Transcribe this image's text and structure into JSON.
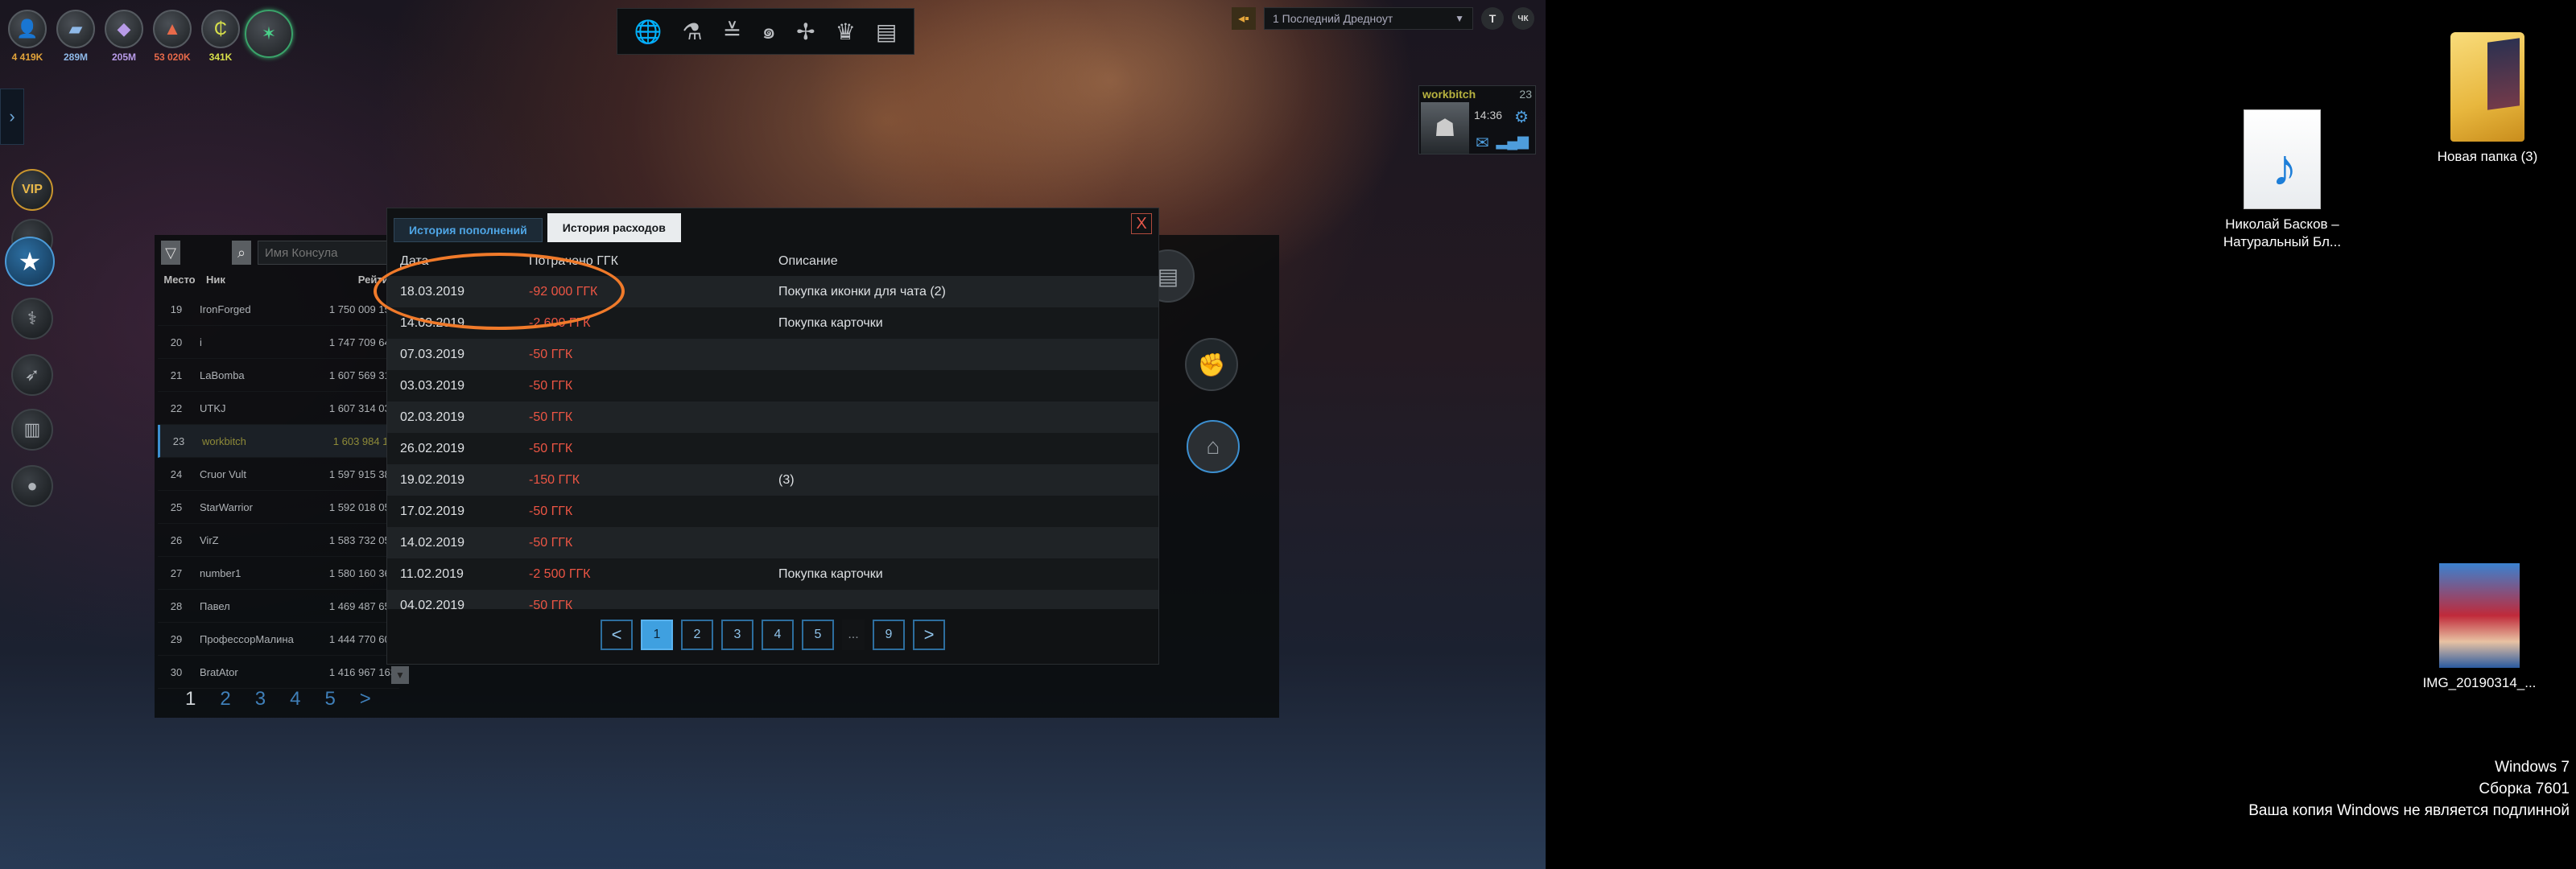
{
  "resources": [
    {
      "icon": "population-icon",
      "glyph": "👤",
      "value": "4 419K",
      "color": "#e3a43a"
    },
    {
      "icon": "metal-icon",
      "glyph": "▰",
      "value": "289M",
      "color": "#8fb9e8"
    },
    {
      "icon": "crystal-icon",
      "glyph": "◆",
      "value": "205M",
      "color": "#b89be8"
    },
    {
      "icon": "fuel-icon",
      "glyph": "▲",
      "value": "53 020K",
      "color": "#e86a4a"
    },
    {
      "icon": "credits-icon",
      "glyph": "₵",
      "value": "341K",
      "color": "#d8e04a"
    },
    {
      "icon": "premium-icon",
      "glyph": "✶",
      "value": "",
      "color": "#4ad28a"
    }
  ],
  "toolbar": {
    "icons": [
      "globe-icon",
      "flask-icon",
      "wings-icon",
      "galaxy-icon",
      "cross-sword-icon",
      "crown-icon",
      "chat-icon"
    ],
    "glyphs": [
      "🌐",
      "⚗",
      "≚",
      "๑",
      "✢",
      "♛",
      "▤"
    ]
  },
  "top_right": {
    "select_value": "1 Последний Дредноут",
    "t_label": "T",
    "c_label": "ЧК",
    "w_label": "W"
  },
  "sidebar": {
    "vip_label": "VIP"
  },
  "rating": {
    "search_placeholder": "Имя Консула",
    "headers": {
      "place": "Место",
      "nick": "Ник",
      "rating": "Рейтинг"
    },
    "rows": [
      {
        "place": "19",
        "nick": "IronForged",
        "score": "1 750 009 151",
        "me": false
      },
      {
        "place": "20",
        "nick": "i",
        "score": "1 747 709 646",
        "me": false
      },
      {
        "place": "21",
        "nick": "LaBomba",
        "score": "1 607 569 317",
        "me": false
      },
      {
        "place": "22",
        "nick": "UTKJ",
        "score": "1 607 314 034",
        "me": false
      },
      {
        "place": "23",
        "nick": "workbitch",
        "score": "1 603 984 111",
        "me": true
      },
      {
        "place": "24",
        "nick": "Cruor Vult",
        "score": "1 597 915 388",
        "me": false
      },
      {
        "place": "25",
        "nick": "StarWarrior",
        "score": "1 592 018 057",
        "me": false
      },
      {
        "place": "26",
        "nick": "VirZ",
        "score": "1 583 732 053",
        "me": false
      },
      {
        "place": "27",
        "nick": "number1",
        "score": "1 580 160 366",
        "me": false
      },
      {
        "place": "28",
        "nick": "Павел",
        "score": "1 469 487 652",
        "me": false
      },
      {
        "place": "29",
        "nick": "ПрофессорМалина",
        "score": "1 444 770 606",
        "me": false
      },
      {
        "place": "30",
        "nick": "BratAtor",
        "score": "1 416 967 163",
        "me": false
      }
    ],
    "pages": [
      "1",
      "2",
      "3",
      "4",
      "5",
      ">"
    ]
  },
  "player": {
    "name": "workbitch",
    "level": "23",
    "time": "14:36"
  },
  "modal": {
    "tabs": [
      {
        "label": "История пополнений",
        "active": false
      },
      {
        "label": "История расходов",
        "active": true
      }
    ],
    "close_label": "X",
    "headers": {
      "date": "Дата",
      "spent": "Потрачено ГГК",
      "desc": "Описание"
    },
    "rows": [
      {
        "date": "18.03.2019",
        "spent": "-92 000 ГГК",
        "desc": "Покупка иконки для чата (2)"
      },
      {
        "date": "14.03.2019",
        "spent": "-2 600 ГГК",
        "desc": "Покупка карточки"
      },
      {
        "date": "07.03.2019",
        "spent": "-50 ГГК",
        "desc": ""
      },
      {
        "date": "03.03.2019",
        "spent": "-50 ГГК",
        "desc": ""
      },
      {
        "date": "02.03.2019",
        "spent": "-50 ГГК",
        "desc": ""
      },
      {
        "date": "26.02.2019",
        "spent": "-50 ГГК",
        "desc": ""
      },
      {
        "date": "19.02.2019",
        "spent": "-150 ГГК",
        "desc": "(3)"
      },
      {
        "date": "17.02.2019",
        "spent": "-50 ГГК",
        "desc": ""
      },
      {
        "date": "14.02.2019",
        "spent": "-50 ГГК",
        "desc": ""
      },
      {
        "date": "11.02.2019",
        "spent": "-2 500 ГГК",
        "desc": "Покупка карточки"
      },
      {
        "date": "04.02.2019",
        "spent": "-50 ГГК",
        "desc": ""
      }
    ],
    "pager": {
      "prev": "<",
      "pages": [
        "1",
        "2",
        "3",
        "4",
        "5"
      ],
      "dots": "...",
      "last": "9",
      "next": ">",
      "current": "1"
    }
  },
  "desktop": {
    "icons": [
      {
        "name": "folder",
        "label": "Новая папка (3)"
      },
      {
        "name": "media-file",
        "label": "Николай Басков –\nНатуральный Бл..."
      },
      {
        "name": "image-file",
        "label": "IMG_20190314_..."
      }
    ],
    "watermark": [
      "Windows 7",
      "Сборка 7601",
      "Ваша копия Windows не является подлинной"
    ]
  }
}
